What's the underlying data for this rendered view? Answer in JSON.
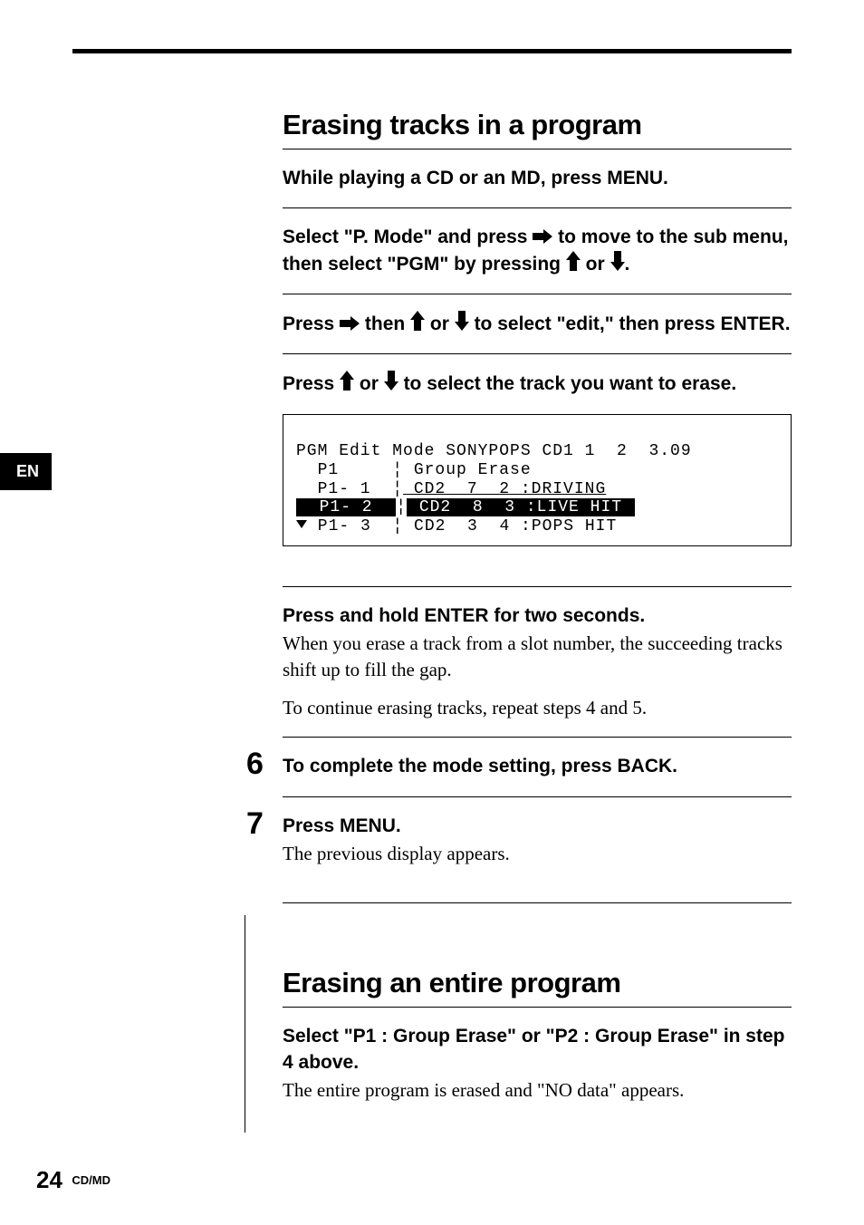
{
  "sideTab": "EN",
  "section1": {
    "title": "Erasing tracks in a program",
    "steps": {
      "s1": "While playing a CD or an MD, press MENU.",
      "s2a": "Select \"P. Mode\" and press ",
      "s2b": " to move to the sub menu, then select \"PGM\" by pressing ",
      "s2c": " or ",
      "s2d": ".",
      "s3a": "Press ",
      "s3b": " then ",
      "s3c": " or ",
      "s3d": " to  select \"edit,\" then press ENTER.",
      "s4a": "Press ",
      "s4b": " or ",
      "s4c": " to select the track you want to erase.",
      "display": {
        "l1": "PGM Edit Mode SONYPOPS CD1 1  2  3.09",
        "l2a": "  P1     ",
        "l2b": " Group Erase",
        "l3a": "  P1- 1  ",
        "l3b": " CD2  7  2 :DRIVING",
        "l4a": "  P1- 2  ",
        "l4b": " CD2  8  3 :LIVE HIT ",
        "l5a": " P1- 3  ",
        "l5b": " CD2  3  4 :POPS HIT"
      },
      "s5title": "Press and hold ENTER for two seconds.",
      "s5body1": "When you erase a track from a slot number, the succeeding tracks shift up to fill the gap.",
      "s5body2": "To continue erasing tracks, repeat steps 4 and 5.",
      "s6num": "6",
      "s6": "To complete the mode setting, press BACK.",
      "s7num": "7",
      "s7title": "Press MENU.",
      "s7body": "The previous display appears."
    }
  },
  "section2": {
    "title": "Erasing an entire program",
    "s1title": "Select \"P1 : Group Erase\" or  \"P2 : Group Erase\" in step 4 above.",
    "s1body": "The entire program is erased and \"NO data\" appears."
  },
  "footer": {
    "page": "24",
    "section": "CD/MD"
  },
  "icons": {
    "right": "arrow-right",
    "up": "arrow-up",
    "down": "arrow-down"
  }
}
